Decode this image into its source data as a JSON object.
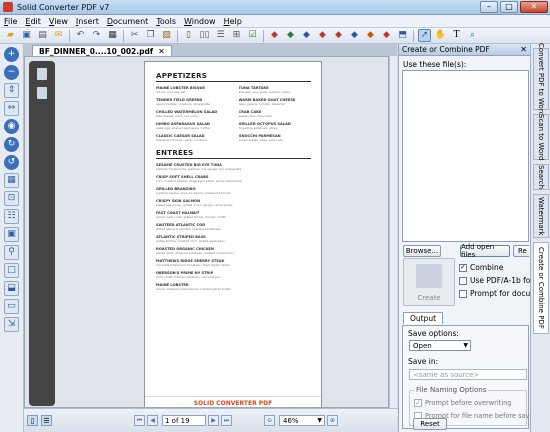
{
  "window": {
    "title": "Solid Converter PDF v7"
  },
  "menu": [
    "File",
    "Edit",
    "View",
    "Insert",
    "Document",
    "Tools",
    "Window",
    "Help"
  ],
  "toolbar": {
    "icons": [
      "open-icon",
      "save-icon",
      "print-icon",
      "email-icon",
      "undo-icon",
      "redo-icon",
      "scan-icon",
      "cut-icon",
      "copy-icon",
      "paste-icon",
      "single-page-icon",
      "two-page-icon",
      "continuous-icon",
      "fit-icon",
      "check-icon",
      "convert-word-icon",
      "convert-excel-icon",
      "convert-html-icon",
      "convert-text-icon",
      "convert-image-icon",
      "convert-pdfa-icon",
      "convert-powerpoint-icon",
      "convert-xml-icon",
      "extract-icon",
      "select-icon",
      "hand-icon",
      "text-tool-icon",
      "zoom-icon"
    ]
  },
  "left_tools": [
    "zoom-in-icon",
    "zoom-out-icon",
    "fit-height-icon",
    "fit-width-icon",
    "view-icon",
    "rotate-icon",
    "rotate-left-icon",
    "tables-icon",
    "ocr-icon",
    "forms-icon",
    "image-icon",
    "link-icon",
    "shape-icon",
    "stamp-icon",
    "page-icon",
    "extract-icon"
  ],
  "document": {
    "tab_label": "BF_DINNER_0....10_002.pdf",
    "menu": {
      "appetizers_heading": "APPETIZERS",
      "appetizers_left": [
        {
          "name": "MAINE LOBSTER BISQUE",
          "desc": "dill oil, cold sea salt"
        },
        {
          "name": "TENDER FIELD GREENS",
          "desc": "aged cheddar, croutons, vinaigrette"
        },
        {
          "name": "CHILLED WATERMELON SALAD",
          "desc": "feta cheese, mint, red onion"
        },
        {
          "name": "JUMBO ASPARAGUS SALAD",
          "desc": "quail egg, shaved parmesan, truffle"
        },
        {
          "name": "CLASSIC CAESAR SALAD",
          "desc": "hearts of romaine, garlic croutons"
        }
      ],
      "appetizers_right": [
        {
          "name": "TUNA TARTARE",
          "desc": "avocado, soy glaze, wonton crisps"
        },
        {
          "name": "WARM BAKED GOAT CHEESE",
          "desc": "baby greens, tomato, balsamic"
        },
        {
          "name": "CRAB CAKE",
          "desc": "sweet corn, chive aioli"
        },
        {
          "name": "GRILLED OCTOPUS SALAD",
          "desc": "fingerling potatoes, olives"
        },
        {
          "name": "GNOCCHI PARMESAN",
          "desc": "brown butter, sage, pine nuts"
        }
      ],
      "entrees_heading": "ENTRÉES",
      "entrees": [
        {
          "name": "SESAME CRUSTED BIG EYE TUNA",
          "desc": "shiitake mushrooms, jasmine rice, ginger soy vinaigrette"
        },
        {
          "name": "CRISP SOFT SHELL CRABS",
          "desc": "corn, roasted pepper, asparagus salad, sauce remoulade"
        },
        {
          "name": "GRILLED BRANZINO",
          "desc": "summer beans, olive oil, lemon, preserved fennel"
        },
        {
          "name": "CRISPY SKIN SALMON",
          "desc": "sweet pea puree, grilled onion, ginger carrot puree"
        },
        {
          "name": "FAST COAST HALIBUT",
          "desc": "lemon herb crust, grilled fennel, tomato confit"
        },
        {
          "name": "SAUTÉED ATLANTIC COD",
          "desc": "wilted spinach, tomato, roasted cauliflower"
        },
        {
          "name": "ATLANTIC STRIPED BASS",
          "desc": "petite shrimp, roasted corn, grilled asparagus"
        },
        {
          "name": "ROASTED ORGANIC CHICKEN",
          "desc": "sweet garlic whipped potatoes, roasted mushrooms"
        },
        {
          "name": "MATTHEWS RIDGE SHERRY STEAK",
          "desc": "marinated heirloom tomatoes, fried potato sticks"
        },
        {
          "name": "OBERSON'S PRIME NY STRIP",
          "desc": "duck confit mashed potatoes, red wine jus"
        },
        {
          "name": "MAINE LOBSTER",
          "desc": "lemon whipped mascarpone, roasted garlic butter"
        }
      ],
      "footer_brand": "SOLID CONVERTER PDF"
    }
  },
  "status": {
    "page_field": "1 of 19",
    "zoom": "46%"
  },
  "panel": {
    "title": "Create or Combine PDF",
    "use_label": "Use these file(s):",
    "browse_label": "Browse...",
    "add_open_label": "Add open files",
    "reset_label": "Re",
    "create_label": "Create",
    "combine_label": "Combine",
    "combine_checked": true,
    "pdfa_label": "Use PDF/A-1b format",
    "pdfa_checked": false,
    "prompt_label": "Prompt for document",
    "prompt_checked": false,
    "output_tab": "Output",
    "save_options_label": "Save options:",
    "save_options_value": "Open",
    "save_in_label": "Save in:",
    "save_in_value": "<same as source>",
    "naming_title": "File Naming Options",
    "prompt_overwrite_label": "Prompt before overwriting",
    "prompt_overwrite_checked": true,
    "prompt_filename_label": "Prompt for file name before saving",
    "prompt_filename_checked": false,
    "reset_bottom_label": "Reset"
  },
  "side_tabs": [
    "Convert PDF to Word",
    "Scan to Word",
    "Search",
    "Watermark",
    "Create or Combine PDF"
  ],
  "colors": {
    "accent": "#3b6fb9",
    "brand": "#d24a1d"
  }
}
